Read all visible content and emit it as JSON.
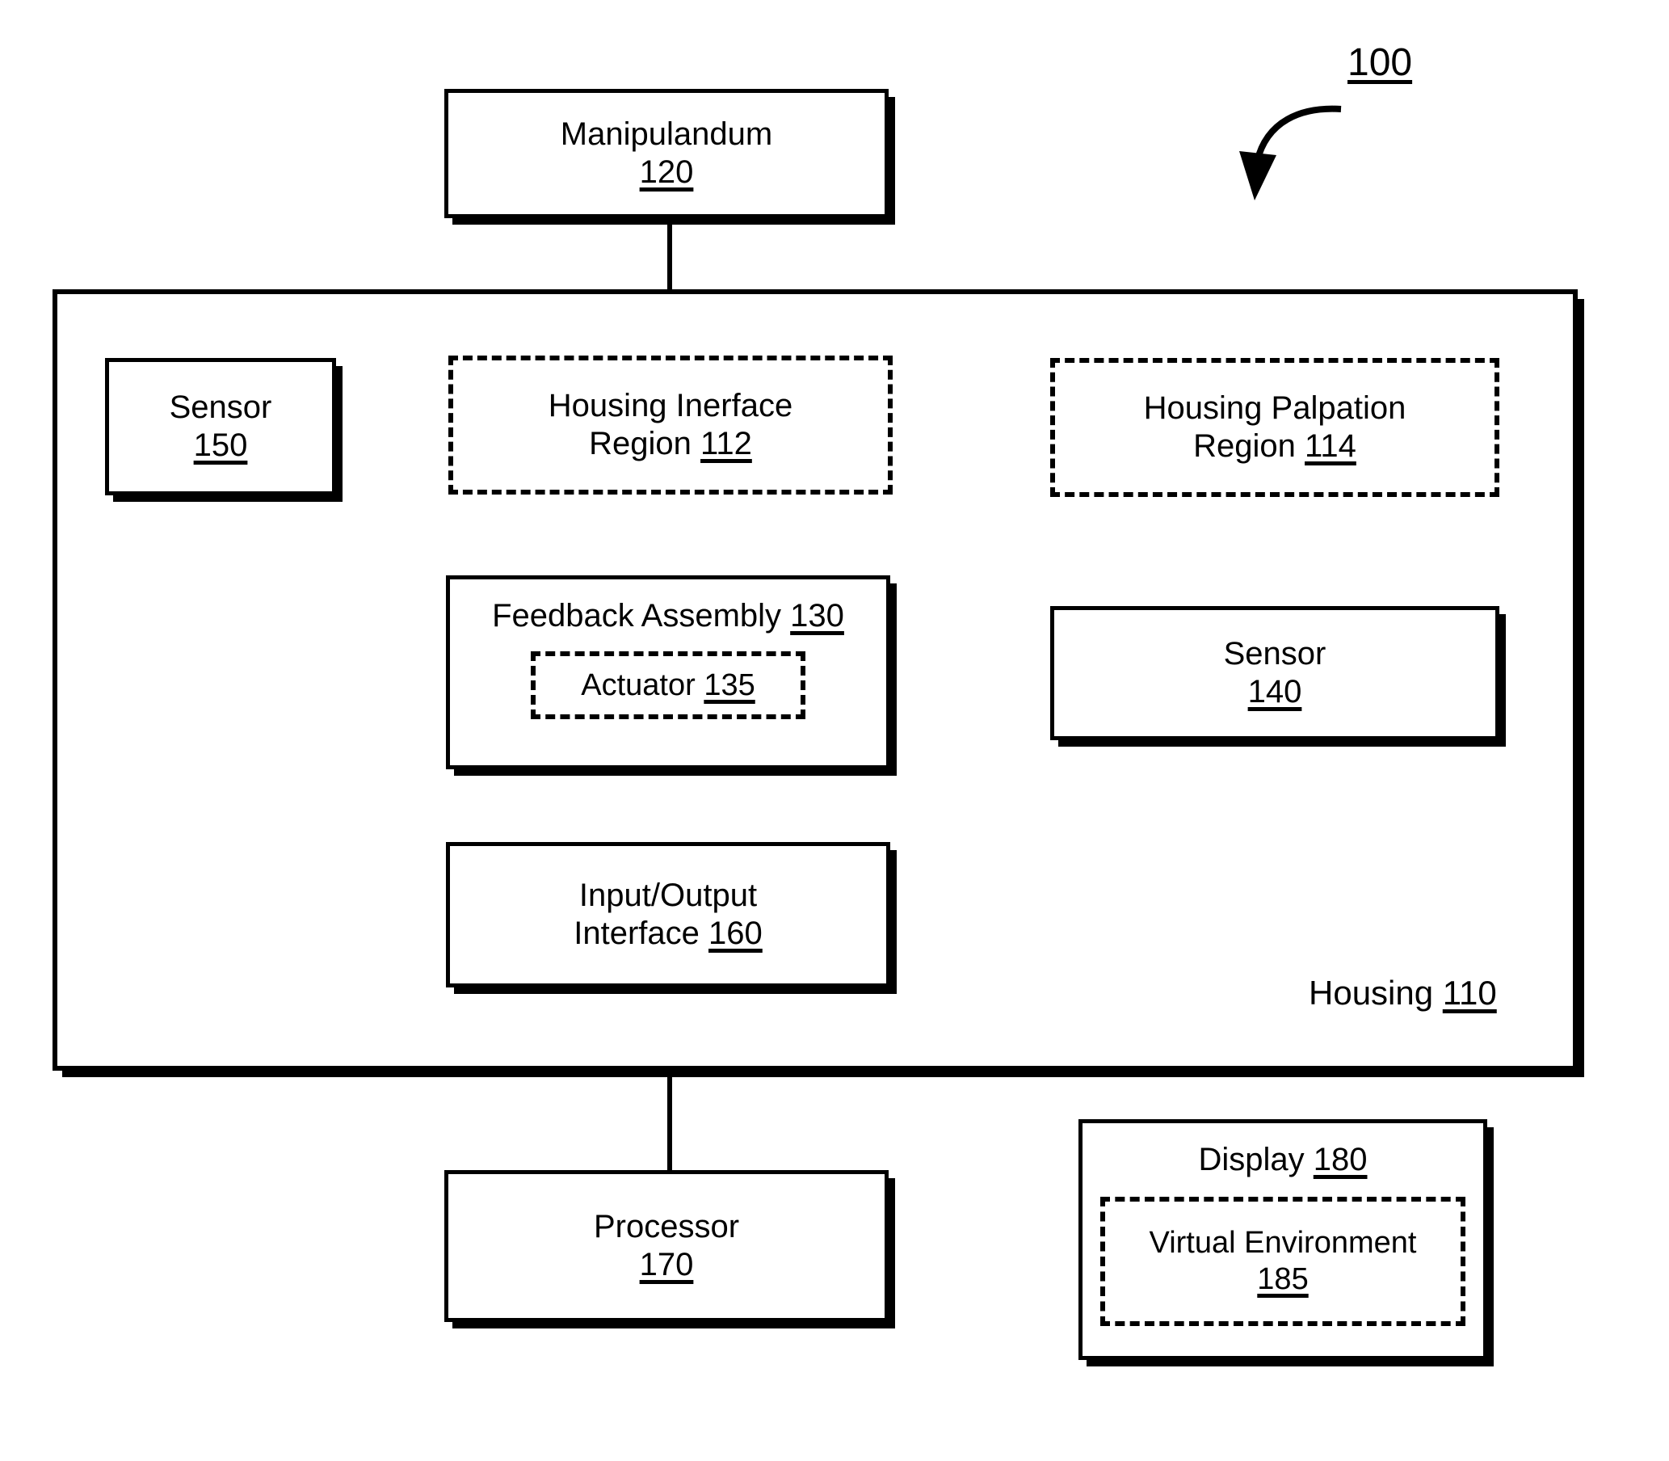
{
  "figure": {
    "reference_numeral": "100",
    "pointer_icon": "curved-arrow-icon"
  },
  "housing": {
    "label": "Housing",
    "numeral": "110"
  },
  "blocks": {
    "manipulandum": {
      "label": "Manipulandum",
      "numeral": "120"
    },
    "housing_interface_region": {
      "line1": "Housing  Inerface",
      "line2": "Region",
      "numeral": "112"
    },
    "housing_palpation_region": {
      "line1": "Housing Palpation",
      "line2": "Region",
      "numeral": "114"
    },
    "sensor_150": {
      "label": "Sensor",
      "numeral": "150"
    },
    "sensor_140": {
      "label": "Sensor",
      "numeral": "140"
    },
    "feedback_assembly": {
      "label": "Feedback Assembly",
      "numeral": "130"
    },
    "actuator": {
      "label": "Actuator",
      "numeral": "135"
    },
    "io_interface": {
      "line1": "Input/Output",
      "line2": "Interface",
      "numeral": "160"
    },
    "processor": {
      "label": "Processor",
      "numeral": "170"
    },
    "display": {
      "label": "Display",
      "numeral": "180"
    },
    "virtual_environment": {
      "label": "Virtual Environment",
      "numeral": "185"
    }
  },
  "colors": {
    "stroke": "#000000",
    "background": "#ffffff"
  }
}
